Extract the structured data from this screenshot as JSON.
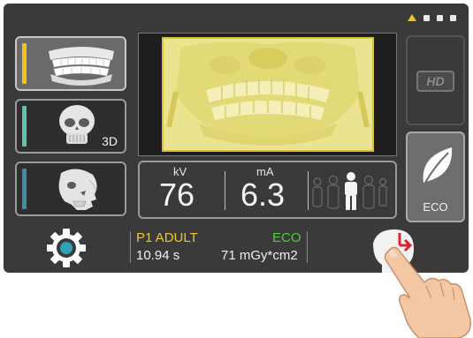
{
  "topbar": {
    "indicators": [
      "warning-triangle",
      "dot",
      "dot",
      "dot"
    ]
  },
  "modes": [
    {
      "name": "panoramic",
      "accent": "#f0c419",
      "icon": "jaw-icon"
    },
    {
      "name": "3d",
      "accent": "#5fc3b4",
      "label": "3D",
      "icon": "skull-3d-icon"
    },
    {
      "name": "cephalometric",
      "accent": "#3e8fa6",
      "icon": "skull-profile-icon"
    }
  ],
  "params": {
    "kv_caption": "kV",
    "kv_value": "76",
    "ma_caption": "mA",
    "ma_value": "6.3"
  },
  "right_buttons": {
    "hd_label": "HD",
    "eco_label": "ECO"
  },
  "status": {
    "profile": "P1 ADULT",
    "mode": "ECO",
    "time": "10.94 s",
    "dose": "71 mGy*cm2"
  },
  "colors": {
    "panel": "#3a3a3a",
    "profile_text": "#e9c52e",
    "eco_text": "#4fcd3c",
    "exposure_arrow": "#d9232e"
  }
}
